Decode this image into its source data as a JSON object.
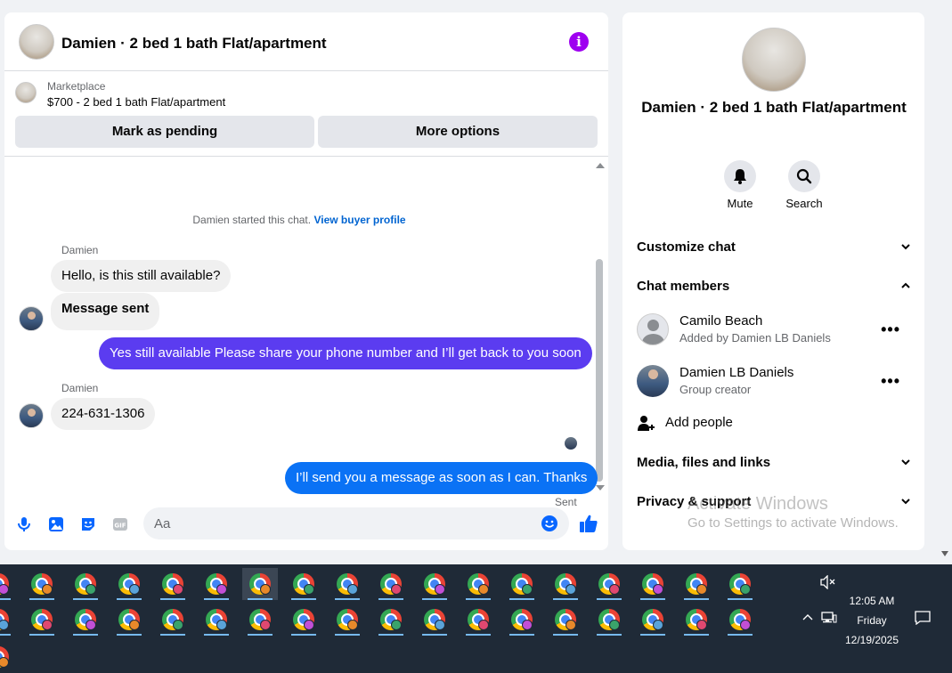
{
  "chat": {
    "title": "Damien · 2 bed 1 bath Flat/apartment",
    "info_icon": "info-icon",
    "marketplace_label": "Marketplace",
    "listing": "$700 - 2 bed 1 bath Flat/apartment",
    "mark_pending_label": "Mark as pending",
    "more_options_label": "More options",
    "system_line": "Damien started this chat.",
    "buyer_profile_link": "View buyer profile",
    "messages": [
      {
        "sender": "Damien",
        "text": "Hello, is this still available?"
      },
      {
        "text": "Message sent"
      },
      {
        "text": "Yes still available Please share your phone number and I’ll get back to you soon",
        "color": "#5b3cf0"
      },
      {
        "sender": "Damien",
        "text": "224-631-1306"
      },
      {
        "text": "I’ll send you a message as soon as I can. Thanks",
        "color": "#0a72f5"
      }
    ],
    "sent_status": "Sent",
    "composer": {
      "placeholder": "Aa",
      "icons": [
        "microphone-icon",
        "photo-icon",
        "sticker-icon",
        "gif-icon",
        "emoji-icon",
        "like-icon"
      ]
    },
    "accent": "#0866ff"
  },
  "info": {
    "title": "Damien · 2 bed 1 bath Flat/apartment",
    "mute_label": "Mute",
    "search_label": "Search",
    "customize_chat": "Customize chat",
    "chat_members": "Chat members",
    "members": [
      {
        "name": "Camilo Beach",
        "sub": "Added by Damien LB Daniels"
      },
      {
        "name": "Damien LB Daniels",
        "sub": "Group creator"
      }
    ],
    "add_people": "Add people",
    "media_files": "Media, files and links",
    "privacy_support": "Privacy & support"
  },
  "watermark": {
    "line1": "Activate Windows",
    "line2": "Go to Settings to activate Windows."
  },
  "taskbar": {
    "time": "12:05 AM",
    "day": "Friday",
    "date": "12/19/2025",
    "badge_colors": [
      "#c24fd6",
      "#e8892a",
      "#3aa36b",
      "#5aa3d9",
      "#e04870"
    ]
  }
}
